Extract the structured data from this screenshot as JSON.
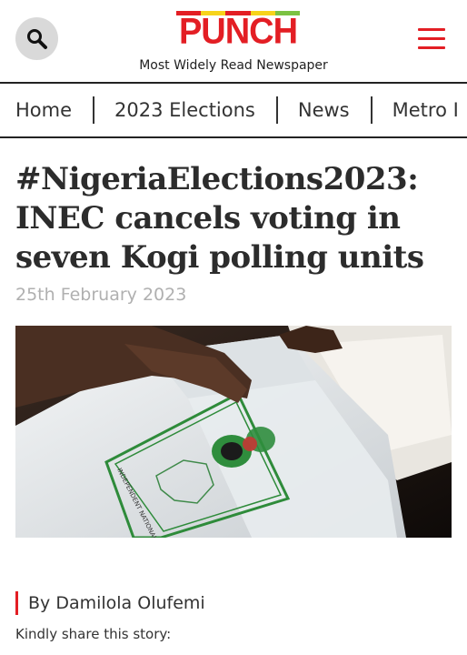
{
  "header": {
    "logo_text": "PUNCH",
    "tagline": "Most Widely Read Newspaper",
    "logo_bar_colors": [
      "#e31e24",
      "#f7d31b",
      "#e31e24",
      "#f7d31b",
      "#7cc242"
    ],
    "search_icon": "search-icon",
    "menu_icon": "hamburger-menu-icon",
    "accent_color": "#e31e24"
  },
  "nav": {
    "items": [
      "Home",
      "2023 Elections",
      "News",
      "Metro I"
    ]
  },
  "article": {
    "title": "#NigeriaElections2023: INEC cancels voting in seven Kogi polling units",
    "date": "25th February 2023",
    "image_caption_text": "INDEPENDENT NATIONAL ELECTORAL COMMISSION",
    "author": "By Damilola Olufemi",
    "share_prompt": "Kindly share this story:"
  }
}
